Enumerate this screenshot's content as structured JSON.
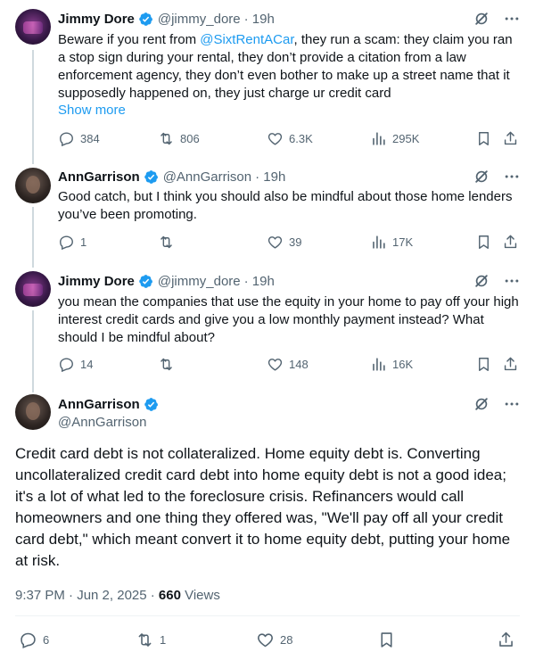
{
  "tweets": [
    {
      "name": "Jimmy Dore",
      "handle": "@jimmy_dore",
      "time": "· 19h",
      "text_before": "Beware if you rent from ",
      "mention": "@SixtRentACar",
      "text_after": ", they run a scam: they claim you ran a stop sign during your rental, they don’t provide a citation from a law enforcement agency, they don’t even bother to make up a street name that it supposedly happened on, they just charge ur credit card",
      "show_more": "Show more",
      "replies": "384",
      "retweets": "806",
      "likes": "6.3K",
      "views": "295K"
    },
    {
      "name": "AnnGarrison",
      "handle": "@AnnGarrison",
      "time": "· 19h",
      "text": "Good catch, but I think you should also be mindful about those home lenders you’ve been promoting.",
      "replies": "1",
      "retweets": "",
      "likes": "39",
      "views": "17K"
    },
    {
      "name": "Jimmy Dore",
      "handle": "@jimmy_dore",
      "time": "· 19h",
      "text": "you mean the companies that use the equity in your home to pay off your high interest credit cards and give you a low monthly payment instead? What should I be mindful about?",
      "replies": "14",
      "retweets": "",
      "likes": "148",
      "views": "16K"
    }
  ],
  "main": {
    "name": "AnnGarrison",
    "handle": "@AnnGarrison",
    "text": "Credit card debt is not collateralized. Home equity debt is.  Converting uncollateralized credit card debt into home equity debt is not a good idea; it's a lot of what led to the foreclosure crisis. Refinancers would call homeowners and one thing they offered was, \"We'll pay off all your credit card debt,\" which meant convert it to home equity debt, putting your home at risk.",
    "timestamp": "9:37 PM · Jun 2, 2025 · ",
    "views_count": "660",
    "views_label": " Views",
    "replies": "6",
    "retweets": "1",
    "likes": "28"
  },
  "colors": {
    "accent": "#1d9bf0",
    "muted": "#536471",
    "text": "#0f1419",
    "line": "#cfd9de"
  },
  "icons": [
    "verified-badge-icon",
    "grok-icon",
    "more-icon",
    "reply-icon",
    "retweet-icon",
    "like-icon",
    "views-icon",
    "bookmark-icon",
    "share-icon"
  ]
}
